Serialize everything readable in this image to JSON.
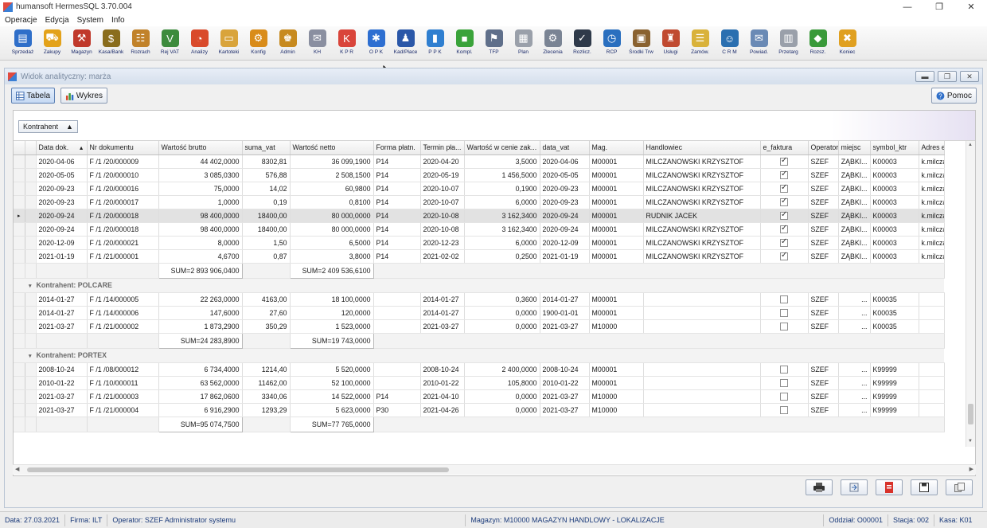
{
  "window": {
    "title": "humansoft HermesSQL 3.70.004",
    "minimize": "—",
    "maximize": "❐",
    "close": "✕"
  },
  "menu": [
    "Operacje",
    "Edycja",
    "System",
    "Info"
  ],
  "toolbar": [
    {
      "label": "Sprzedaż",
      "icon": "sales-icon",
      "color": "#2f6fc9",
      "glyph": "▤"
    },
    {
      "label": "Zakupy",
      "icon": "cart-icon",
      "color": "#e3a21a",
      "glyph": "⛟"
    },
    {
      "label": "Magazyn",
      "icon": "forklift-icon",
      "color": "#c0392b",
      "glyph": "⚒"
    },
    {
      "label": "Kasa/Bank",
      "icon": "moneybag-icon",
      "color": "#8a6d1d",
      "glyph": "$"
    },
    {
      "label": "Rozrach",
      "icon": "abacus-icon",
      "color": "#c1822a",
      "glyph": "☷"
    },
    {
      "label": "Rej VAT",
      "icon": "vat-icon",
      "color": "#3d8b3d",
      "glyph": "V"
    },
    {
      "label": "Analizy",
      "icon": "pie-chart-icon",
      "color": "#d94a2b",
      "glyph": "◔"
    },
    {
      "label": "Kartoteki",
      "icon": "folder-icon",
      "color": "#d9a43b",
      "glyph": "▭"
    },
    {
      "label": "Konfig",
      "icon": "gear-icon",
      "color": "#d98c1a",
      "glyph": "⚙"
    },
    {
      "label": "Admin",
      "icon": "admin-icon",
      "color": "#c78a1f",
      "glyph": "♚"
    },
    {
      "label": "KH",
      "icon": "kh-icon",
      "color": "#8a8fa0",
      "glyph": "✉"
    },
    {
      "label": "K P R",
      "icon": "kpr-icon",
      "color": "#d9453b",
      "glyph": "K"
    },
    {
      "label": "O P K",
      "icon": "opk-icon",
      "color": "#2e6fd1",
      "glyph": "✱"
    },
    {
      "label": "Kad/Płace",
      "icon": "payroll-icon",
      "color": "#2a57a8",
      "glyph": "♟"
    },
    {
      "label": "P P K",
      "icon": "ppk-icon",
      "color": "#2f7fd0",
      "glyph": "▮"
    },
    {
      "label": "Kompl.",
      "icon": "box-icon",
      "color": "#3aa33a",
      "glyph": "■"
    },
    {
      "label": "TFP",
      "icon": "tfp-icon",
      "color": "#5f6f8a",
      "glyph": "⚑"
    },
    {
      "label": "Plan",
      "icon": "plan-icon",
      "color": "#9aa0aa",
      "glyph": "▦"
    },
    {
      "label": "Zlecenia",
      "icon": "tools-icon",
      "color": "#7a8494",
      "glyph": "⚙"
    },
    {
      "label": "Rozlicz.",
      "icon": "settle-icon",
      "color": "#2f3a4a",
      "glyph": "✓"
    },
    {
      "label": "RCP",
      "icon": "clock-icon",
      "color": "#2a6fbf",
      "glyph": "◷"
    },
    {
      "label": "Środki Trw",
      "icon": "fixed-assets-icon",
      "color": "#8a6230",
      "glyph": "▣"
    },
    {
      "label": "Usługi",
      "icon": "services-icon",
      "color": "#c04a30",
      "glyph": "♜"
    },
    {
      "label": "Zamów.",
      "icon": "order-icon",
      "color": "#d9b23a",
      "glyph": "☰"
    },
    {
      "label": "C R M",
      "icon": "crm-icon",
      "color": "#2a6fb0",
      "glyph": "☺"
    },
    {
      "label": "Powiad.",
      "icon": "notify-icon",
      "color": "#6a8ab5",
      "glyph": "✉"
    },
    {
      "label": "Przetarg",
      "icon": "tender-icon",
      "color": "#9aa0aa",
      "glyph": "▥"
    },
    {
      "label": "Rozsz.",
      "icon": "extension-icon",
      "color": "#3a9a3a",
      "glyph": "◆"
    },
    {
      "label": "Koniec",
      "icon": "exit-icon",
      "color": "#e0a020",
      "glyph": "✖"
    }
  ],
  "subwindow": {
    "title": "Widok analityczny: marża",
    "view_table": "Tabela",
    "view_chart": "Wykres",
    "help": "Pomoc",
    "group_by": "Kontrahent"
  },
  "columns": [
    "Data dok.",
    "Nr dokumentu",
    "Wartość brutto",
    "suma_vat",
    "Wartość netto",
    "Forma płatn.",
    "Termin pła...",
    "Wartość w cenie zak...",
    "data_vat",
    "Mag.",
    "Handlowiec",
    "e_faktura",
    "Operator",
    "miejsc",
    "symbol_ktr",
    "Adres e-fakt"
  ],
  "group1_rows": [
    {
      "date": "2020-04-06",
      "nr": "F /1 /20/000009",
      "brutto": "44 402,0000",
      "vat": "8302,81",
      "netto": "36 099,1900",
      "forma": "P14",
      "termin": "2020-04-20",
      "zak": "3,5000",
      "dvat": "2020-04-06",
      "mag": "M00001",
      "handl": "MILCZANOWSKI KRZYSZTOF",
      "ef": true,
      "oper": "SZEF",
      "miejsc": "ZĄBKI...",
      "sym": "K00003",
      "adres": "k.milczars"
    },
    {
      "date": "2020-05-05",
      "nr": "F /1 /20/000010",
      "brutto": "3 085,0300",
      "vat": "576,88",
      "netto": "2 508,1500",
      "forma": "P14",
      "termin": "2020-05-19",
      "zak": "1 456,5000",
      "dvat": "2020-05-05",
      "mag": "M00001",
      "handl": "MILCZANOWSKI KRZYSZTOF",
      "ef": true,
      "oper": "SZEF",
      "miejsc": "ZĄBKI...",
      "sym": "K00003",
      "adres": "k.milczars"
    },
    {
      "date": "2020-09-23",
      "nr": "F /1 /20/000016",
      "brutto": "75,0000",
      "vat": "14,02",
      "netto": "60,9800",
      "forma": "P14",
      "termin": "2020-10-07",
      "zak": "0,1900",
      "dvat": "2020-09-23",
      "mag": "M00001",
      "handl": "MILCZANOWSKI KRZYSZTOF",
      "ef": true,
      "oper": "SZEF",
      "miejsc": "ZĄBKI...",
      "sym": "K00003",
      "adres": "k.milczars"
    },
    {
      "date": "2020-09-23",
      "nr": "F /1 /20/000017",
      "brutto": "1,0000",
      "vat": "0,19",
      "netto": "0,8100",
      "forma": "P14",
      "termin": "2020-10-07",
      "zak": "6,0000",
      "dvat": "2020-09-23",
      "mag": "M00001",
      "handl": "MILCZANOWSKI KRZYSZTOF",
      "ef": true,
      "oper": "SZEF",
      "miejsc": "ZĄBKI...",
      "sym": "K00003",
      "adres": "k.milczars"
    },
    {
      "date": "2020-09-24",
      "nr": "F /1 /20/000018",
      "brutto": "98 400,0000",
      "vat": "18400,00",
      "netto": "80 000,0000",
      "forma": "P14",
      "termin": "2020-10-08",
      "zak": "3 162,3400",
      "dvat": "2020-09-24",
      "mag": "M00001",
      "handl": "RUDNIK JACEK",
      "ef": true,
      "oper": "SZEF",
      "miejsc": "ZĄBKI...",
      "sym": "K00003",
      "adres": "k.milczars",
      "selected": true
    },
    {
      "date": "2020-09-24",
      "nr": "F /1 /20/000018",
      "brutto": "98 400,0000",
      "vat": "18400,00",
      "netto": "80 000,0000",
      "forma": "P14",
      "termin": "2020-10-08",
      "zak": "3 162,3400",
      "dvat": "2020-09-24",
      "mag": "M00001",
      "handl": "MILCZANOWSKI KRZYSZTOF",
      "ef": true,
      "oper": "SZEF",
      "miejsc": "ZĄBKI...",
      "sym": "K00003",
      "adres": "k.milczars"
    },
    {
      "date": "2020-12-09",
      "nr": "F /1 /20/000021",
      "brutto": "8,0000",
      "vat": "1,50",
      "netto": "6,5000",
      "forma": "P14",
      "termin": "2020-12-23",
      "zak": "6,0000",
      "dvat": "2020-12-09",
      "mag": "M00001",
      "handl": "MILCZANOWSKI KRZYSZTOF",
      "ef": true,
      "oper": "SZEF",
      "miejsc": "ZĄBKI...",
      "sym": "K00003",
      "adres": "k.milczars"
    },
    {
      "date": "2021-01-19",
      "nr": "F /1 /21/000001",
      "brutto": "4,6700",
      "vat": "0,87",
      "netto": "3,8000",
      "forma": "P14",
      "termin": "2021-02-02",
      "zak": "0,2500",
      "dvat": "2021-01-19",
      "mag": "M00001",
      "handl": "MILCZANOWSKI KRZYSZTOF",
      "ef": true,
      "oper": "SZEF",
      "miejsc": "ZĄBKI...",
      "sym": "K00003",
      "adres": "k.milczars"
    }
  ],
  "group1_sum": {
    "brutto": "SUM=2 893 906,0400",
    "netto": "SUM=2 409 536,6100"
  },
  "group2": {
    "title": "Kontrahent: POLCARE",
    "rows": [
      {
        "date": "2014-01-27",
        "nr": "F /1 /14/000005",
        "brutto": "22 263,0000",
        "vat": "4163,00",
        "netto": "18 100,0000",
        "forma": "",
        "termin": "2014-01-27",
        "zak": "0,3600",
        "dvat": "2014-01-27",
        "mag": "M00001",
        "handl": "",
        "ef": false,
        "oper": "SZEF",
        "miejsc": "...",
        "sym": "K00035",
        "adres": ""
      },
      {
        "date": "2014-01-27",
        "nr": "F /1 /14/000006",
        "brutto": "147,6000",
        "vat": "27,60",
        "netto": "120,0000",
        "forma": "",
        "termin": "2014-01-27",
        "zak": "0,0000",
        "dvat": "1900-01-01",
        "mag": "M00001",
        "handl": "",
        "ef": false,
        "oper": "SZEF",
        "miejsc": "...",
        "sym": "K00035",
        "adres": ""
      },
      {
        "date": "2021-03-27",
        "nr": "F /1 /21/000002",
        "brutto": "1 873,2900",
        "vat": "350,29",
        "netto": "1 523,0000",
        "forma": "",
        "termin": "2021-03-27",
        "zak": "0,0000",
        "dvat": "2021-03-27",
        "mag": "M10000",
        "handl": "",
        "ef": false,
        "oper": "SZEF",
        "miejsc": "...",
        "sym": "K00035",
        "adres": ""
      }
    ],
    "sum": {
      "brutto": "SUM=24 283,8900",
      "netto": "SUM=19 743,0000"
    }
  },
  "group3": {
    "title": "Kontrahent: PORTEX",
    "rows": [
      {
        "date": "2008-10-24",
        "nr": "F /1 /08/000012",
        "brutto": "6 734,4000",
        "vat": "1214,40",
        "netto": "5 520,0000",
        "forma": "",
        "termin": "2008-10-24",
        "zak": "2 400,0000",
        "dvat": "2008-10-24",
        "mag": "M00001",
        "handl": "",
        "ef": false,
        "oper": "SZEF",
        "miejsc": "...",
        "sym": "K99999",
        "adres": ""
      },
      {
        "date": "2010-01-22",
        "nr": "F /1 /10/000011",
        "brutto": "63 562,0000",
        "vat": "11462,00",
        "netto": "52 100,0000",
        "forma": "",
        "termin": "2010-01-22",
        "zak": "105,8000",
        "dvat": "2010-01-22",
        "mag": "M00001",
        "handl": "",
        "ef": false,
        "oper": "SZEF",
        "miejsc": "...",
        "sym": "K99999",
        "adres": ""
      },
      {
        "date": "2021-03-27",
        "nr": "F /1 /21/000003",
        "brutto": "17 862,0600",
        "vat": "3340,06",
        "netto": "14 522,0000",
        "forma": "P14",
        "termin": "2021-04-10",
        "zak": "0,0000",
        "dvat": "2021-03-27",
        "mag": "M10000",
        "handl": "",
        "ef": false,
        "oper": "SZEF",
        "miejsc": "...",
        "sym": "K99999",
        "adres": ""
      },
      {
        "date": "2021-03-27",
        "nr": "F /1 /21/000004",
        "brutto": "6 916,2900",
        "vat": "1293,29",
        "netto": "5 623,0000",
        "forma": "P30",
        "termin": "2021-04-26",
        "zak": "0,0000",
        "dvat": "2021-03-27",
        "mag": "M10000",
        "handl": "",
        "ef": false,
        "oper": "SZEF",
        "miejsc": "...",
        "sym": "K99999",
        "adres": ""
      }
    ],
    "sum": {
      "brutto": "SUM=95 074,7500",
      "netto": "SUM=77 765,0000"
    }
  },
  "status": {
    "data": "Data: 27.03.2021",
    "firma": "Firma: ILT",
    "operator": "Operator: SZEF Administrator systemu",
    "magazyn": "Magazyn: M10000 MAGAZYN HANDLOWY - LOKALIZACJE",
    "oddzial": "Oddział: O00001",
    "stacja": "Stacja: 002",
    "kasa": "Kasa: K01"
  }
}
